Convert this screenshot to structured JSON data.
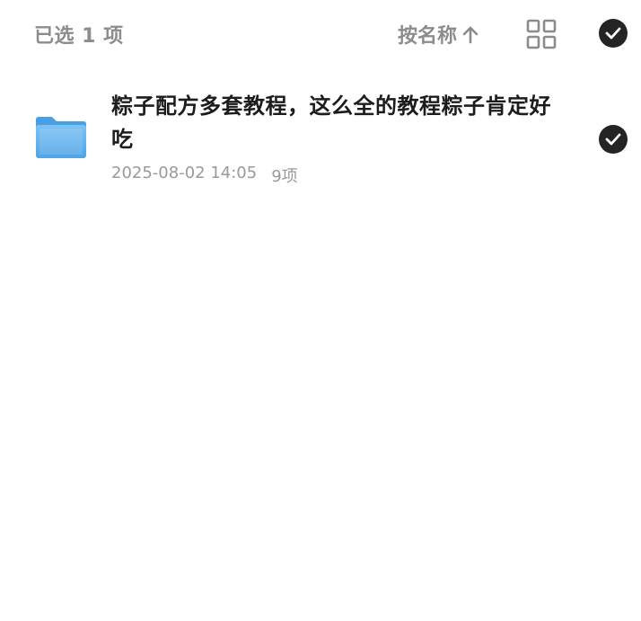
{
  "header": {
    "selected_text": "已选 1 项",
    "sort_label": "按名称",
    "sort_direction": "ascending",
    "grid_icon": "grid-view-icon",
    "select_all_icon": "check-circle-icon"
  },
  "files": [
    {
      "name": "粽子配方多套教程，这么全的教程粽子肯定好吃",
      "date": "2025-08-02 14:05",
      "count": "9项",
      "type": "folder",
      "selected": true
    }
  ],
  "colors": {
    "check_bg": "#242424",
    "muted_text": "#8c8c8c",
    "folder_blue": "#5aaeee"
  }
}
